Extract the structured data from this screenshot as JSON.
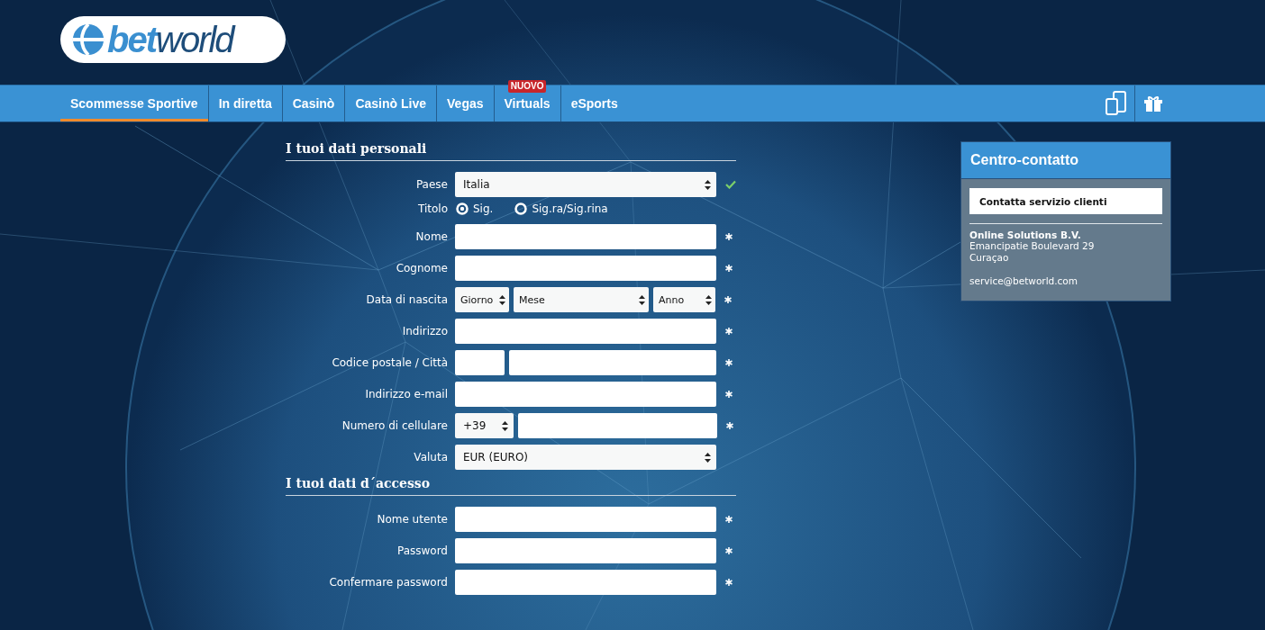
{
  "logo": {
    "part1": "bet",
    "part2": "world"
  },
  "nav": [
    {
      "label": "Scommesse Sportive",
      "selected": true
    },
    {
      "label": "In diretta",
      "selected": false
    },
    {
      "label": "Casinò",
      "selected": false
    },
    {
      "label": "Casinò Live",
      "selected": false
    },
    {
      "label": "Vegas",
      "selected": false
    },
    {
      "label": "Virtuals",
      "selected": false,
      "badge": "NUOVO"
    },
    {
      "label": "eSports",
      "selected": false
    }
  ],
  "sections": [
    {
      "title": "I tuoi dati personali",
      "rows": [
        {
          "kind": "select",
          "label": "Paese",
          "value": "Italia",
          "valid": true
        },
        {
          "kind": "radio",
          "label": "Titolo",
          "options": [
            {
              "label": "Sig.",
              "selected": true
            },
            {
              "label": "Sig.ra/Sig.rina",
              "selected": false
            }
          ]
        },
        {
          "kind": "text",
          "label": "Nome",
          "required": true
        },
        {
          "kind": "text",
          "label": "Cognome",
          "required": true
        },
        {
          "kind": "date",
          "label": "Data di nascita",
          "selects": [
            "Giorno",
            "Mese",
            "Anno"
          ],
          "required": true
        },
        {
          "kind": "text",
          "label": "Indirizzo",
          "required": true
        },
        {
          "kind": "postal",
          "label": "Codice postale / Città",
          "required": true
        },
        {
          "kind": "text",
          "label": "Indirizzo e-mail",
          "required": true
        },
        {
          "kind": "phone",
          "label": "Numero di cellulare",
          "value": "+39",
          "required": true
        },
        {
          "kind": "select",
          "label": "Valuta",
          "value": "EUR (EURO)"
        }
      ]
    },
    {
      "title": "I tuoi dati d´accesso",
      "rows": [
        {
          "kind": "text",
          "label": "Nome utente",
          "required": true
        },
        {
          "kind": "text",
          "label": "Password",
          "required": true
        },
        {
          "kind": "text",
          "label": "Confermare password",
          "required": true
        }
      ]
    }
  ],
  "contact": {
    "title": "Centro-contatto",
    "button": "Contatta servizio clienti",
    "company": "Online Solutions B.V.",
    "address": [
      "Emancipatie Boulevard 29",
      "Curaçao"
    ],
    "email": "service@betworld.com"
  }
}
